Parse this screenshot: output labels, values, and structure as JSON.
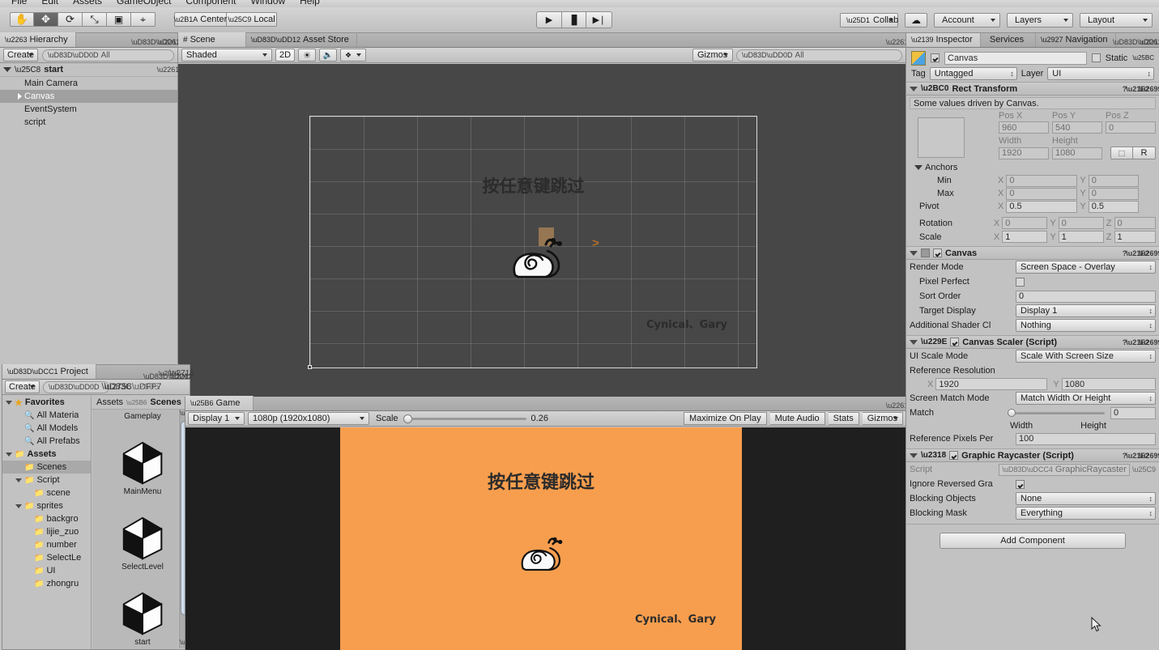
{
  "menubar": {
    "items": [
      "File",
      "Edit",
      "Assets",
      "GameObject",
      "Component",
      "Window",
      "Help"
    ]
  },
  "toolbar": {
    "tools": [
      {
        "name": "hand-tool",
        "glyph": "✋",
        "active": false
      },
      {
        "name": "move-tool",
        "glyph": "✥",
        "active": true
      },
      {
        "name": "rotate-tool",
        "glyph": "⟳",
        "active": false
      },
      {
        "name": "scale-tool",
        "glyph": "⤡",
        "active": false
      },
      {
        "name": "rect-tool",
        "glyph": "▣",
        "active": false
      },
      {
        "name": "transform-tool",
        "glyph": "⌖",
        "active": false
      }
    ],
    "pivot_mode": "Center",
    "pivot_rotation": "Local",
    "play": "▶",
    "pause": "▐▌",
    "step": "▶❘",
    "collab": "Collab",
    "cloud": "☁",
    "account": "Account",
    "layers": "Layers",
    "layout": "Layout"
  },
  "hierarchy": {
    "tab": "Hierarchy",
    "create_label": "Create",
    "search_placeholder": "All",
    "scene_name": "start",
    "items": [
      {
        "label": "Main Camera",
        "indent": 1,
        "arrow": false,
        "selected": false
      },
      {
        "label": "Canvas",
        "indent": 1,
        "arrow": true,
        "selected": true
      },
      {
        "label": "EventSystem",
        "indent": 1,
        "arrow": false,
        "selected": false
      },
      {
        "label": "script",
        "indent": 1,
        "arrow": false,
        "selected": false
      }
    ]
  },
  "scene": {
    "tabs": [
      {
        "label": "Scene",
        "icon": "#",
        "active": true
      },
      {
        "label": "Asset Store",
        "icon": "🔒",
        "active": false
      }
    ],
    "draw_mode": "Shaded",
    "two_d": "2D",
    "light_icon": "☀",
    "audio_icon": "🔈",
    "fx_icon": "❖",
    "gizmos": "Gizmos",
    "search_placeholder": "All",
    "canvas": {
      "skip_text": "按任意键跳过",
      "credit_text": "Cynical、Gary",
      "bg_color": "#f79e4e"
    }
  },
  "game": {
    "tab": "Game",
    "display": "Display 1",
    "resolution": "1080p (1920x1080)",
    "scale_label": "Scale",
    "scale_value": "0.26",
    "maximize": "Maximize On Play",
    "mute": "Mute Audio",
    "stats": "Stats",
    "gizmos": "Gizmos",
    "canvas": {
      "skip_text": "按任意键跳过",
      "credit_text": "Cynical、Gary",
      "bg_color": "#f79e4e"
    }
  },
  "project": {
    "tab": "Project",
    "create_label": "Create",
    "search_placeholder": "",
    "breadcrumb": [
      "Assets",
      "Scenes"
    ],
    "tree": [
      {
        "label": "Favorites",
        "indent": 0,
        "arrow": "open",
        "icon": "star",
        "bold": true,
        "selected": false
      },
      {
        "label": "All Materia",
        "indent": 1,
        "arrow": "none",
        "icon": "search",
        "bold": false,
        "selected": false
      },
      {
        "label": "All Models",
        "indent": 1,
        "arrow": "none",
        "icon": "search",
        "bold": false,
        "selected": false
      },
      {
        "label": "All Prefabs",
        "indent": 1,
        "arrow": "none",
        "icon": "search",
        "bold": false,
        "selected": false
      },
      {
        "label": "Assets",
        "indent": 0,
        "arrow": "open",
        "icon": "folder",
        "bold": true,
        "selected": false
      },
      {
        "label": "Scenes",
        "indent": 1,
        "arrow": "none",
        "icon": "folder",
        "bold": false,
        "selected": true
      },
      {
        "label": "Script",
        "indent": 1,
        "arrow": "open",
        "icon": "folder",
        "bold": false,
        "selected": false
      },
      {
        "label": "scene",
        "indent": 2,
        "arrow": "none",
        "icon": "folder",
        "bold": false,
        "selected": false
      },
      {
        "label": "sprites",
        "indent": 1,
        "arrow": "open",
        "icon": "folder",
        "bold": false,
        "selected": false
      },
      {
        "label": "backgro",
        "indent": 2,
        "arrow": "none",
        "icon": "folder",
        "bold": false,
        "selected": false
      },
      {
        "label": "lijie_zuo",
        "indent": 2,
        "arrow": "none",
        "icon": "folder",
        "bold": false,
        "selected": false
      },
      {
        "label": "number",
        "indent": 2,
        "arrow": "none",
        "icon": "folder",
        "bold": false,
        "selected": false
      },
      {
        "label": "SelectLe",
        "indent": 2,
        "arrow": "none",
        "icon": "folder",
        "bold": false,
        "selected": false
      },
      {
        "label": "UI",
        "indent": 2,
        "arrow": "none",
        "icon": "folder",
        "bold": false,
        "selected": false
      },
      {
        "label": "zhongru",
        "indent": 2,
        "arrow": "none",
        "icon": "folder",
        "bold": false,
        "selected": false
      }
    ],
    "assets": [
      {
        "label": "Gameplay"
      },
      {
        "label": "MainMenu"
      },
      {
        "label": "SelectLevel"
      },
      {
        "label": "start"
      }
    ]
  },
  "inspector": {
    "tabs": [
      {
        "label": "Inspector",
        "active": true
      },
      {
        "label": "Services",
        "active": false
      },
      {
        "label": "Navigation",
        "active": false
      }
    ],
    "object_name": "Canvas",
    "object_enabled": true,
    "static_label": "Static",
    "tag_label": "Tag",
    "tag_value": "Untagged",
    "layer_label": "Layer",
    "layer_value": "UI",
    "rect_transform": {
      "title": "Rect Transform",
      "note": "Some values driven by Canvas.",
      "headers": [
        "Pos X",
        "Pos Y",
        "Pos Z"
      ],
      "pos": [
        "960",
        "540",
        "0"
      ],
      "size_headers": [
        "Width",
        "Height"
      ],
      "size": [
        "1920",
        "1080"
      ],
      "blueprint_btn": "⬚",
      "raw_btn": "R",
      "anchors_label": "Anchors",
      "min_label": "Min",
      "min": [
        "0",
        "0"
      ],
      "max_label": "Max",
      "max": [
        "0",
        "0"
      ],
      "pivot_label": "Pivot",
      "pivot": [
        "0.5",
        "0.5"
      ],
      "rotation_label": "Rotation",
      "rotation": [
        "0",
        "0",
        "0"
      ],
      "scale_label": "Scale",
      "scale": [
        "1",
        "1",
        "1"
      ]
    },
    "canvas_component": {
      "title": "Canvas",
      "enabled": true,
      "render_mode_label": "Render Mode",
      "render_mode_value": "Screen Space - Overlay",
      "pixel_perfect_label": "Pixel Perfect",
      "pixel_perfect": false,
      "sort_order_label": "Sort Order",
      "sort_order_value": "0",
      "target_display_label": "Target Display",
      "target_display_value": "Display 1",
      "shader_channels_label": "Additional Shader Cl",
      "shader_channels_value": "Nothing"
    },
    "canvas_scaler": {
      "title": "Canvas Scaler (Script)",
      "enabled": true,
      "ui_scale_mode_label": "UI Scale Mode",
      "ui_scale_mode_value": "Scale With Screen Size",
      "ref_resolution_label": "Reference Resolution",
      "ref_x": "1920",
      "ref_y": "1080",
      "match_mode_label": "Screen Match Mode",
      "match_mode_value": "Match Width Or Height",
      "match_label": "Match",
      "match_value": "0",
      "match_min": "Width",
      "match_max": "Height",
      "ref_ppu_label": "Reference Pixels Per",
      "ref_ppu_value": "100"
    },
    "graphic_raycaster": {
      "title": "Graphic Raycaster (Script)",
      "enabled": true,
      "script_label": "Script",
      "script_value": "GraphicRaycaster",
      "ignore_reversed_label": "Ignore Reversed Gra",
      "ignore_reversed": true,
      "blocking_objects_label": "Blocking Objects",
      "blocking_objects_value": "None",
      "blocking_mask_label": "Blocking Mask",
      "blocking_mask_value": "Everything"
    },
    "add_component": "Add Component"
  }
}
